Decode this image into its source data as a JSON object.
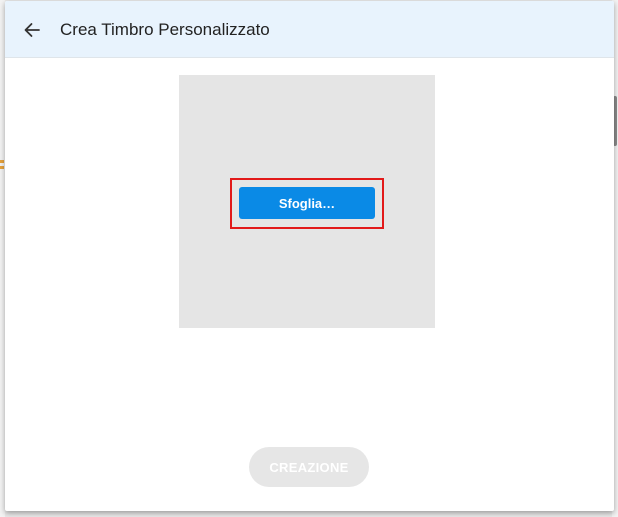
{
  "dialog": {
    "title": "Crea Timbro Personalizzato",
    "back_icon": "arrow-left-icon"
  },
  "preview": {
    "browse_label": "Sfoglia…"
  },
  "footer": {
    "create_label": "CREAZIONE",
    "create_enabled": false
  },
  "colors": {
    "header_bg": "#e8f3fd",
    "preview_bg": "#e5e5e5",
    "primary": "#0a8ae6",
    "highlight": "#e21a1a",
    "disabled_bg": "#e6e6e6"
  }
}
